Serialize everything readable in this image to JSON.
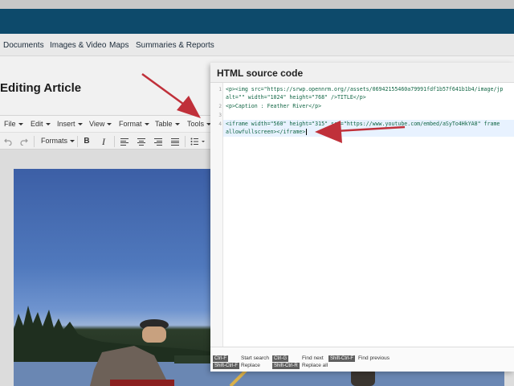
{
  "nav": {
    "items": [
      "Documents",
      "Images & Video",
      "Maps",
      "Summaries & Reports"
    ]
  },
  "page": {
    "title": "Editing Article"
  },
  "menubar": {
    "file": "File",
    "edit": "Edit",
    "insert": "Insert",
    "view": "View",
    "format": "Format",
    "table": "Table",
    "tools": "Tools"
  },
  "toolbar": {
    "formats_label": "Formats",
    "undo_icon": "undo-icon",
    "redo_icon": "redo-icon",
    "bold": "B",
    "italic": "I"
  },
  "modal": {
    "title": "HTML source code",
    "lines": [
      {
        "num": "1",
        "text": "<p><img src=\"https://srwp.opennrm.org//assets/06942155460a79991fdf1b57f641b1b4/image/jp"
      },
      {
        "num": "",
        "text": "alt=\"\" width=\"1024\" height=\"768\" />TITLE</p>"
      },
      {
        "num": "2",
        "text": "<p>Caption : Feather River</p>"
      },
      {
        "num": "3",
        "text": ""
      },
      {
        "num": "4",
        "text": "<iframe width=\"560\" height=\"315\" src=\"https://www.youtube.com/embed/aSyTo4HkYA8\" frame"
      },
      {
        "num": "",
        "text": "allowfullscreen></iframe>"
      }
    ],
    "shortcuts": {
      "start_search_key": "Ctrl-F",
      "start_search": "Start search",
      "find_next_key": "Ctrl-G",
      "find_next": "Find next",
      "find_prev_key": "Shift-Ctrl-F",
      "find_prev": "Find previous",
      "replace_key": "Shift-Ctrl-F",
      "replace": "Replace",
      "replace_all_key": "Shift-Ctrl-R",
      "replace_all": "Replace all"
    }
  },
  "colors": {
    "header_blue": "#0d4a6b",
    "annotation_arrow": "#c0303a",
    "code_green": "#116644"
  }
}
